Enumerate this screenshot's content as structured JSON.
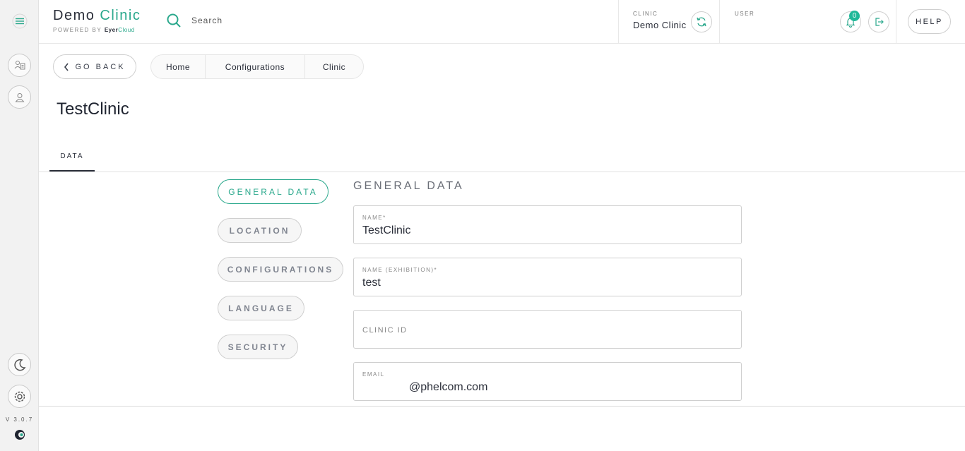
{
  "rail": {
    "version": "V 3.0.7"
  },
  "header": {
    "brand_demo": "Demo",
    "brand_clinic": "Clinic",
    "powered_by": "POWERED BY",
    "eyer": "Eyer",
    "cloud": "Cloud",
    "search_placeholder": "Search",
    "clinic_caption": "CLINIC",
    "clinic_name": "Demo Clinic",
    "user_caption": "USER",
    "notifications_count": "0",
    "help_label": "HELP"
  },
  "subbar": {
    "back_label": "GO BACK",
    "breadcrumbs": [
      "Home",
      "Configurations",
      "Clinic"
    ]
  },
  "page": {
    "title": "TestClinic",
    "tab_label": "DATA"
  },
  "sections": [
    "GENERAL DATA",
    "LOCATION",
    "CONFIGURATIONS",
    "LANGUAGE",
    "SECURITY"
  ],
  "form": {
    "heading": "GENERAL DATA",
    "name_label": "NAME*",
    "name_value": "TestClinic",
    "exhibition_label": "NAME (EXHIBITION)*",
    "exhibition_value": "test",
    "clinic_id_label": "CLINIC ID",
    "email_label": "EMAIL",
    "email_value": "@phelcom.com"
  },
  "colors": {
    "accent": "#2aa88c",
    "badge": "#1fb898"
  }
}
